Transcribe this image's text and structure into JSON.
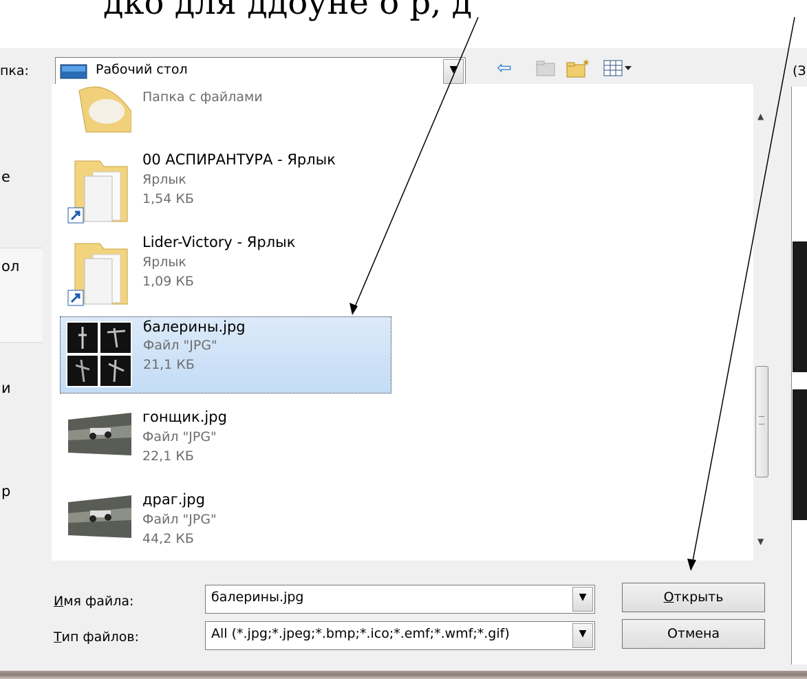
{
  "slide_caption": "дко для ддоуне о р, д",
  "dialog": {
    "look_in_label": "пка:",
    "look_in_value": "Рабочий стол",
    "right_edge_text": "(З",
    "places": [
      "е",
      "ол",
      "и",
      "р"
    ],
    "files": [
      {
        "name": "",
        "type": "Папка с файлами",
        "size": "",
        "icon": "folder-partial-icon"
      },
      {
        "name": "00 АСПИРАНТУРА - Ярлык",
        "type": "Ярлык",
        "size": "1,54 КБ",
        "icon": "folder-shortcut-icon"
      },
      {
        "name": "Lider-Victory - Ярлык",
        "type": "Ярлык",
        "size": "1,09 КБ",
        "icon": "folder-shortcut-icon"
      },
      {
        "name": "балерины.jpg",
        "type": "Файл \"JPG\"",
        "size": "21,1 КБ",
        "icon": "ballerina-thumbnail-icon",
        "selected": true
      },
      {
        "name": "гонщик.jpg",
        "type": "Файл \"JPG\"",
        "size": "22,1 КБ",
        "icon": "racecar-thumbnail-icon"
      },
      {
        "name": "драг.jpg",
        "type": "Файл \"JPG\"",
        "size": "44,2 КБ",
        "icon": "racecar-thumbnail-icon"
      }
    ],
    "filename_label": "Имя файла:",
    "filename_value": "балерины.jpg",
    "filetype_label": "Тип файлов:",
    "filetype_value": "All (*.jpg;*.jpeg;*.bmp;*.ico;*.emf;*.wmf;*.gif)",
    "open_button": "Открыть",
    "cancel_button": "Отмена"
  },
  "colors": {
    "selection": "#c3dcf6",
    "meta_text": "#6d6d6d",
    "dialog_bg": "#f0f0f0"
  }
}
